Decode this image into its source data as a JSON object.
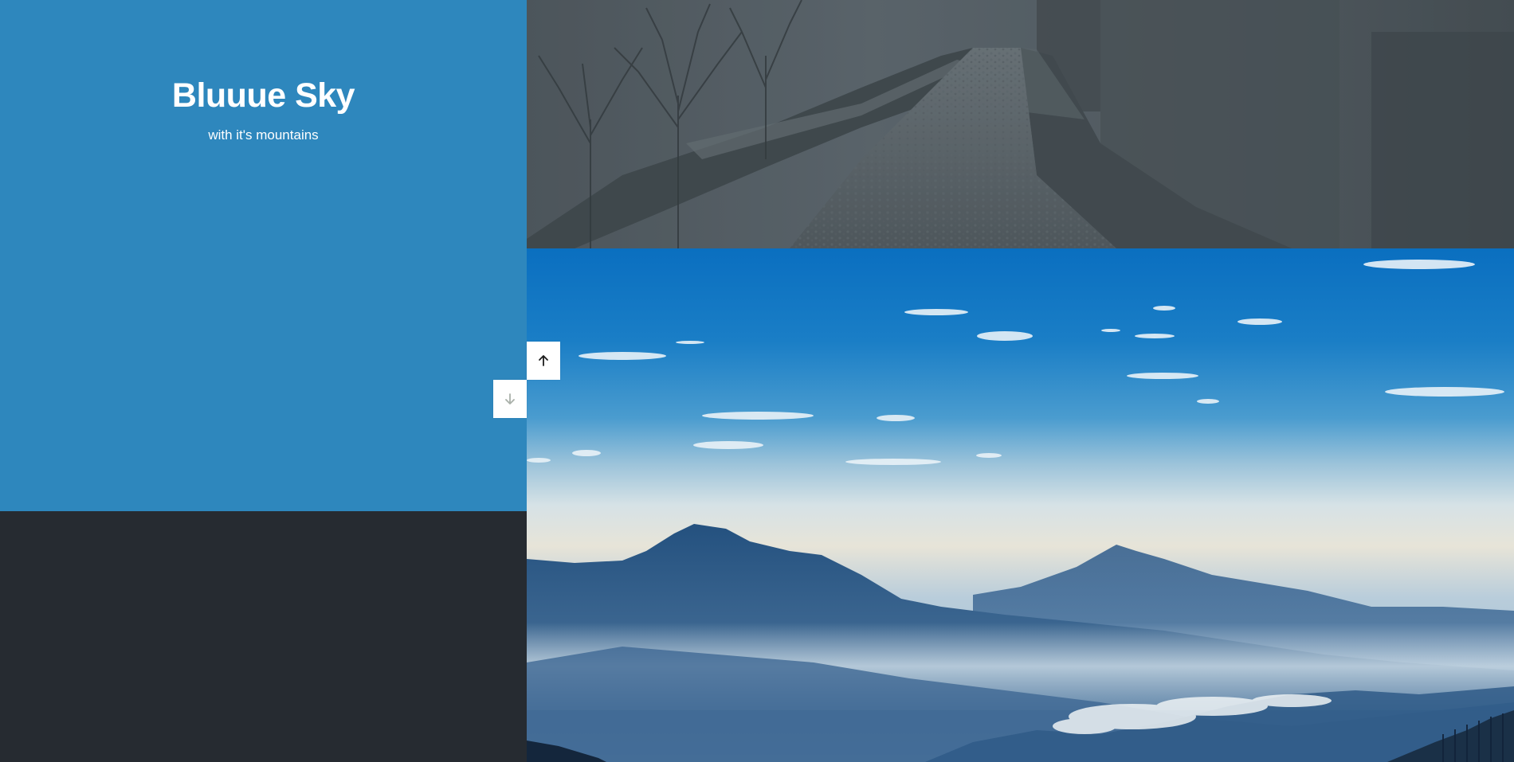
{
  "slide": {
    "title": "Bluuue Sky",
    "subtitle": "with it's mountains"
  },
  "navigation": {
    "up_icon": "arrow-up-icon",
    "down_icon": "arrow-down-icon"
  },
  "colors": {
    "panel_blue": "#2e87bd",
    "panel_dark": "#262b31",
    "button_bg": "#ffffff",
    "arrow_active": "#1c1c1c",
    "arrow_muted": "#a9b0a9"
  }
}
